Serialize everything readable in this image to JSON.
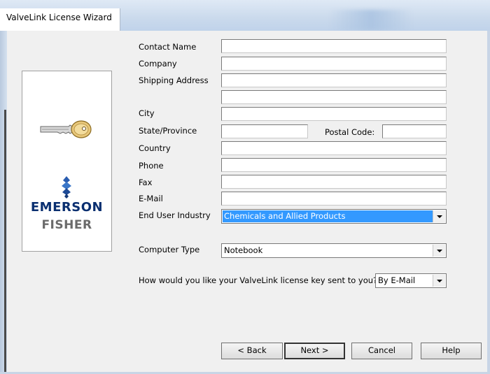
{
  "window": {
    "title": "ValveLink License Wizard"
  },
  "brand": {
    "line1": "EMERSON",
    "line2": "FISHER"
  },
  "form": {
    "contact_name_label": "Contact Name",
    "company_label": "Company",
    "shipping_address_label": "Shipping Address",
    "city_label": "City",
    "state_label": "State/Province",
    "postal_code_label": "Postal Code:",
    "country_label": "Country",
    "phone_label": "Phone",
    "fax_label": "Fax",
    "email_label": "E-Mail",
    "industry_label": "End User Industry",
    "industry_value": "Chemicals and Allied Products",
    "computer_type_label": "Computer Type",
    "computer_type_value": "Notebook",
    "delivery_question": "How would you like your ValveLink license key sent to you?",
    "delivery_value": "By E-Mail"
  },
  "buttons": {
    "back": "< Back",
    "next": "Next >",
    "cancel": "Cancel",
    "help": "Help"
  },
  "colors": {
    "selection": "#3399ff",
    "brand_blue": "#0a2f70",
    "brand_gray": "#6b6b6b"
  }
}
